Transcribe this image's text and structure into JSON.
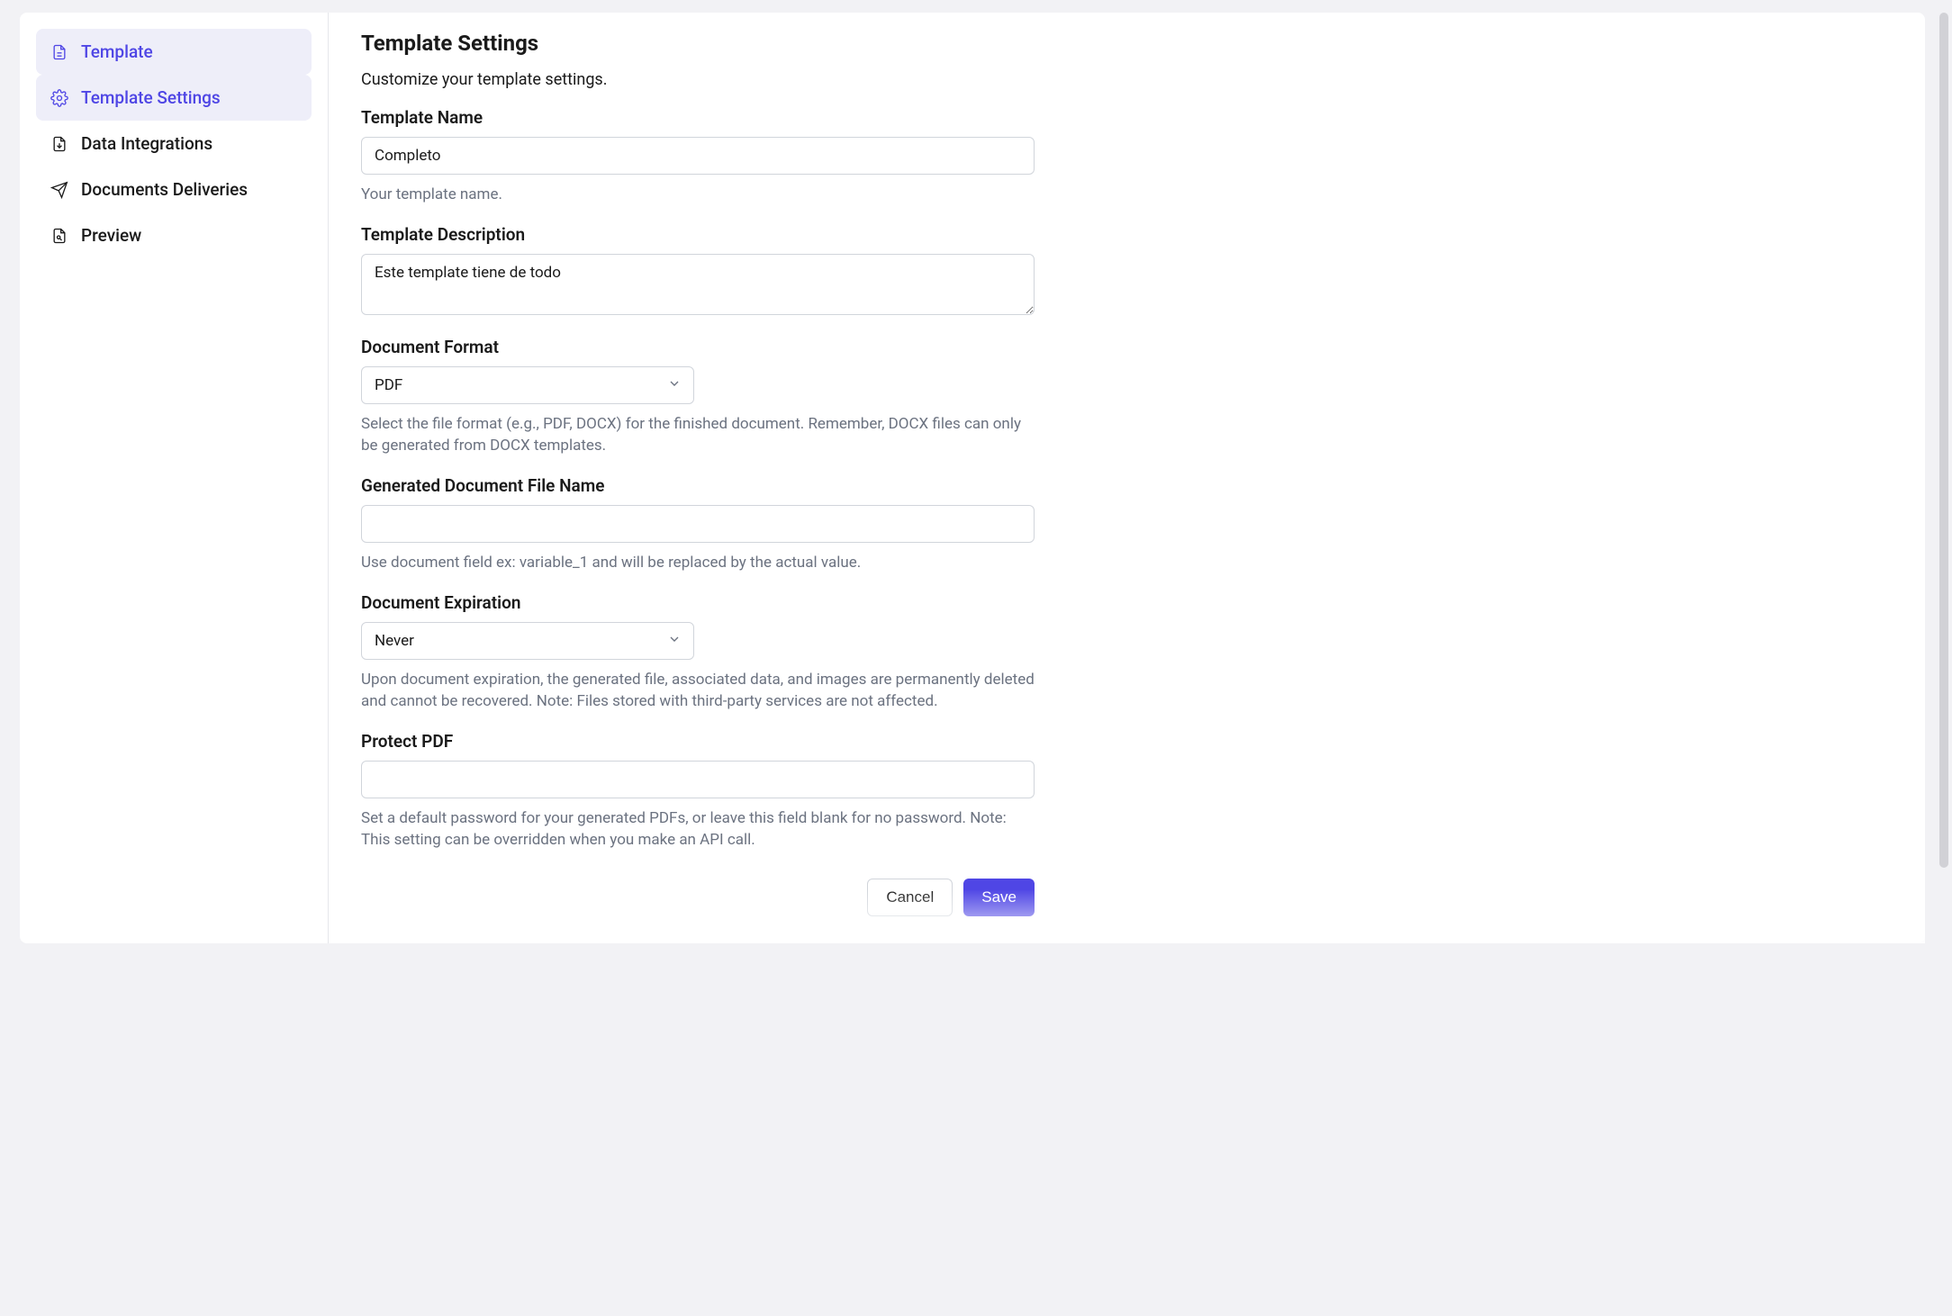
{
  "sidebar": {
    "items": [
      {
        "label": "Template",
        "icon": "file-icon",
        "active": true
      },
      {
        "label": "Template Settings",
        "icon": "gear-icon",
        "active": true
      },
      {
        "label": "Data Integrations",
        "icon": "download-file-icon",
        "active": false
      },
      {
        "label": "Documents Deliveries",
        "icon": "send-icon",
        "active": false
      },
      {
        "label": "Preview",
        "icon": "preview-file-icon",
        "active": false
      }
    ]
  },
  "main": {
    "title": "Template Settings",
    "subtitle": "Customize your template settings.",
    "template_name": {
      "label": "Template Name",
      "value": "Completo",
      "help": "Your template name."
    },
    "template_description": {
      "label": "Template Description",
      "value": "Este template tiene de todo"
    },
    "document_format": {
      "label": "Document Format",
      "value": "PDF",
      "help": "Select the file format (e.g., PDF, DOCX) for the finished document. Remember, DOCX files can only be generated from DOCX templates."
    },
    "generated_file_name": {
      "label": "Generated Document File Name",
      "value": "",
      "help": "Use document field ex: variable_1 and will be replaced by the actual value."
    },
    "document_expiration": {
      "label": "Document Expiration",
      "value": "Never",
      "help": "Upon document expiration, the generated file, associated data, and images are permanently deleted and cannot be recovered. Note: Files stored with third-party services are not affected."
    },
    "protect_pdf": {
      "label": "Protect PDF",
      "value": "",
      "help": "Set a default password for your generated PDFs, or leave this field blank for no password. Note: This setting can be overridden when you make an API call."
    },
    "actions": {
      "cancel": "Cancel",
      "save": "Save"
    }
  }
}
